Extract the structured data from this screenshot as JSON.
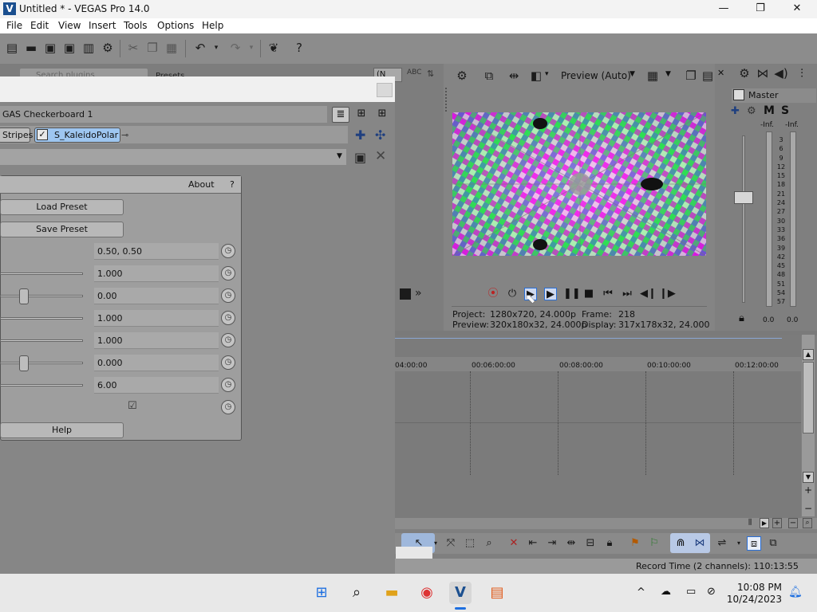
{
  "window": {
    "title": "Untitled * - VEGAS Pro 14.0",
    "minimize": "—",
    "maximize": "❐",
    "close": "✕"
  },
  "menu": [
    "File",
    "Edit",
    "View",
    "Insert",
    "Tools",
    "Options",
    "Help"
  ],
  "toolbar": {
    "icons": [
      "new-icon",
      "open-icon",
      "save-icon",
      "save-as-icon",
      "render-icon",
      "settings-icon",
      "cut-icon",
      "copy-icon",
      "paste-icon",
      "undo-icon",
      "redo-icon",
      "plugin-icon",
      "help-icon"
    ]
  },
  "plugin_dialog": {
    "chain_title": "GAS Checkerboard 1",
    "fx_chain": [
      "Stripes",
      "S_KaleidoPolar"
    ],
    "about_label": "About",
    "help_q": "?",
    "load_preset": "Load Preset",
    "save_preset": "Save Preset",
    "params": [
      {
        "value": "0.50, 0.50",
        "slider": null
      },
      {
        "value": "1.000",
        "slider": 1.0
      },
      {
        "value": "0.00",
        "slider": 0.0
      },
      {
        "value": "1.000",
        "slider": 1.0
      },
      {
        "value": "1.000",
        "slider": 1.0
      },
      {
        "value": "0.000",
        "slider": 0.0
      },
      {
        "value": "6.00",
        "slider": 1.0
      }
    ],
    "checkbox_checked": true,
    "help_label": "Help",
    "search_placeholder": "Search plugins",
    "presets_label": "Presets",
    "dropdown_partial": "(N"
  },
  "preview": {
    "mode_label": "Preview (Auto)",
    "project_label": "Project:",
    "project_value": "1280x720, 24.000p",
    "frame_label": "Frame:",
    "frame_value": "218",
    "preview_label": "Preview:",
    "preview_value": "320x180x32, 24.000p",
    "display_label": "Display:",
    "display_value": "317x178x32, 24.000"
  },
  "master": {
    "label": "Master",
    "m": "M",
    "s": "S",
    "inf_left": "-Inf.",
    "inf_right": "-Inf.",
    "scale": [
      "3",
      "6",
      "9",
      "12",
      "15",
      "18",
      "21",
      "24",
      "27",
      "30",
      "33",
      "36",
      "39",
      "42",
      "45",
      "48",
      "51",
      "54",
      "57"
    ],
    "level_left": "0.0",
    "level_right": "0.0"
  },
  "timeline": {
    "ticks": [
      "04:00:00",
      "00:06:00:00",
      "00:08:00:00",
      "00:10:00:00",
      "00:12:00:00"
    ]
  },
  "status": {
    "record_time": "Record Time (2 channels): 110:13:55"
  },
  "taskbar": {
    "time": "10:08 PM",
    "date": "10/24/2023"
  },
  "colors": {
    "accent": "#2a6fd6",
    "chip_selected": "#9ec6f0"
  }
}
